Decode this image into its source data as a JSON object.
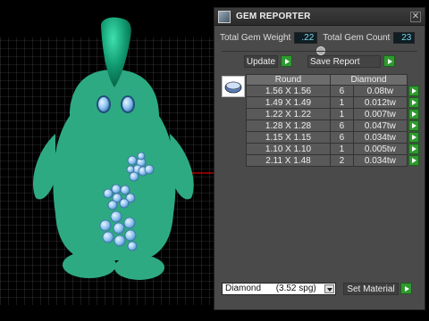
{
  "panel": {
    "title": "GEM REPORTER",
    "close_glyph": "✕",
    "total_weight_label": "Total Gem Weight",
    "total_weight_value": ".22",
    "total_count_label": "Total Gem Count",
    "total_count_value": "23",
    "update_label": "Update",
    "save_report_label": "Save Report",
    "table": {
      "headers": [
        "Round",
        "Diamond"
      ],
      "rows": [
        {
          "size": "1.56 X 1.56",
          "count": "6",
          "weight": "0.08tw"
        },
        {
          "size": "1.49 X 1.49",
          "count": "1",
          "weight": "0.012tw"
        },
        {
          "size": "1.22 X 1.22",
          "count": "1",
          "weight": "0.007tw"
        },
        {
          "size": "1.28 X 1.28",
          "count": "6",
          "weight": "0.047tw"
        },
        {
          "size": "1.15 X 1.15",
          "count": "6",
          "weight": "0.034tw"
        },
        {
          "size": "1.10 X 1.10",
          "count": "1",
          "weight": "0.005tw"
        },
        {
          "size": "2.11 X 1.48",
          "count": "2",
          "weight": "0.034tw"
        }
      ]
    },
    "material_select": "Diamond      (3.52 spg)",
    "set_material_label": "Set Material"
  },
  "icons": {
    "title": "gem-reporter-icon",
    "close": "close-icon",
    "thumb": "gem-shape-icon",
    "go": "play-arrow-icon"
  },
  "colors": {
    "penguin_body": "#2eaa82",
    "panel_bg": "#4a4a4a",
    "go_button": "#2f9a2f",
    "value_text": "#7fd7e8"
  }
}
